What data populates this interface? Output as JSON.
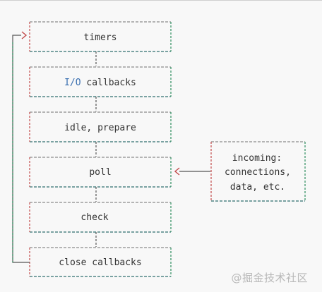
{
  "phases": [
    {
      "id": "timers",
      "label": "timers"
    },
    {
      "id": "io-callbacks",
      "label_prefix": "I/O",
      "label_rest": " callbacks"
    },
    {
      "id": "idle-prepare",
      "label": "idle, prepare"
    },
    {
      "id": "poll",
      "label": "poll"
    },
    {
      "id": "check",
      "label": "check"
    },
    {
      "id": "close-callbacks",
      "label": "close callbacks"
    }
  ],
  "incoming": {
    "lines": [
      "incoming:",
      "connections,",
      "data, etc."
    ]
  },
  "watermark": "@掘金技术社区",
  "colors": {
    "border_top": "#8a8a8a",
    "border_bottom": "#2f6f6f",
    "side_left": "#c24a4a",
    "side_right": "#2f8f5f",
    "connector": "#555555",
    "arrow": "#c24a4a",
    "text": "#333333",
    "accent": "#3a6fb0"
  }
}
